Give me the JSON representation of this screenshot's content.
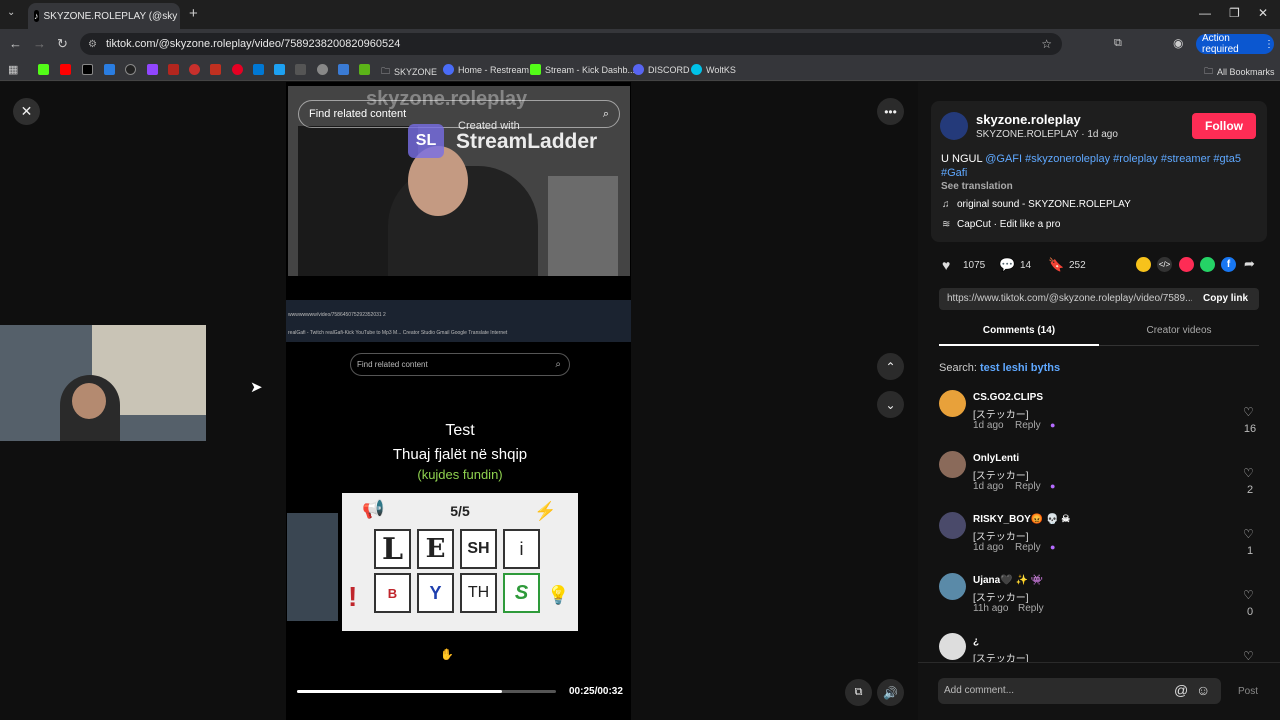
{
  "browser": {
    "tab_title": "SKYZONE.ROLEPLAY (@sky",
    "url": "tiktok.com/@skyzone.roleplay/video/7589238200820960524",
    "action_required": "Action required",
    "bookmarks": [
      "SKYZONE",
      "Home - Restream",
      "Stream - Kick Dashb...",
      "DISCORD",
      "WoltKS"
    ],
    "all_bookmarks": "All Bookmarks"
  },
  "video": {
    "overlay_search": "Find related content",
    "watermark": "skyzone.roleplay",
    "streamladder_created": "Created with",
    "streamladder": "StreamLadder",
    "streamladder_logo": "SL",
    "inner_url": "wwwwwwww/video/758645075292352031 2",
    "inner_tabs": "realGafi - Twitch   realGafi-Kick   YouTube to Mp3 M...   Creator Studio   Gmail   Google Translate   Internet",
    "phone_search": "Find related content",
    "quiz_title": "Test",
    "quiz_line": "Thuaj fjalët në shqip",
    "quiz_hint": "(kujdes fundin)",
    "quiz_score": "5/5",
    "tiles_row1": [
      "L",
      "E",
      "SH",
      "i"
    ],
    "tiles_row2": [
      "B",
      "Y",
      "TH",
      "S"
    ],
    "time": "00:25/00:32",
    "progress": 0.79
  },
  "side": {
    "username": "skyzone.roleplay",
    "subtitle": "SKYZONE.ROLEPLAY · 1d ago",
    "follow": "Follow",
    "caption_plain": "U NGUL ",
    "caption_tags": "@GAFI #skyzoneroleplay #roleplay #streamer #gta5",
    "caption_tag2": "#Gafi",
    "see_translation": "See translation",
    "sound": "original sound - SKYZONE.ROLEPLAY",
    "capcut": "CapCut · Edit like a pro",
    "likes": "1075",
    "comments": "14",
    "saves": "252",
    "link": "https://www.tiktok.com/@skyzone.roleplay/video/7589...",
    "copy_link": "Copy link",
    "tab_comments": "Comments (14)",
    "tab_creator": "Creator videos",
    "search_label": "Search:",
    "search_term": "test leshi byths",
    "comment_list": [
      {
        "name": "CS.GO2.CLIPS",
        "text": "[ステッカー]",
        "time": "1d ago",
        "reply": "Reply",
        "likes": "16"
      },
      {
        "name": "OnlyLenti",
        "text": "[ステッカー]",
        "time": "1d ago",
        "reply": "Reply",
        "likes": "2"
      },
      {
        "name": "RISKY_BOY😡 💀 ☠",
        "text": "[ステッカー]",
        "time": "1d ago",
        "reply": "Reply",
        "likes": "1"
      },
      {
        "name": "Ujana🖤 ✨ 👾",
        "text": "[ステッカー]",
        "time": "11h ago",
        "reply": "Reply",
        "likes": "0"
      },
      {
        "name": "¿",
        "text": "[ステッカー]",
        "time": "",
        "reply": "",
        "likes": ""
      }
    ],
    "add_comment": "Add comment...",
    "post": "Post"
  },
  "colors": {
    "follow": "#fe2c55",
    "link": "#5fa8ff",
    "accent_blue": "#0b57d0"
  }
}
